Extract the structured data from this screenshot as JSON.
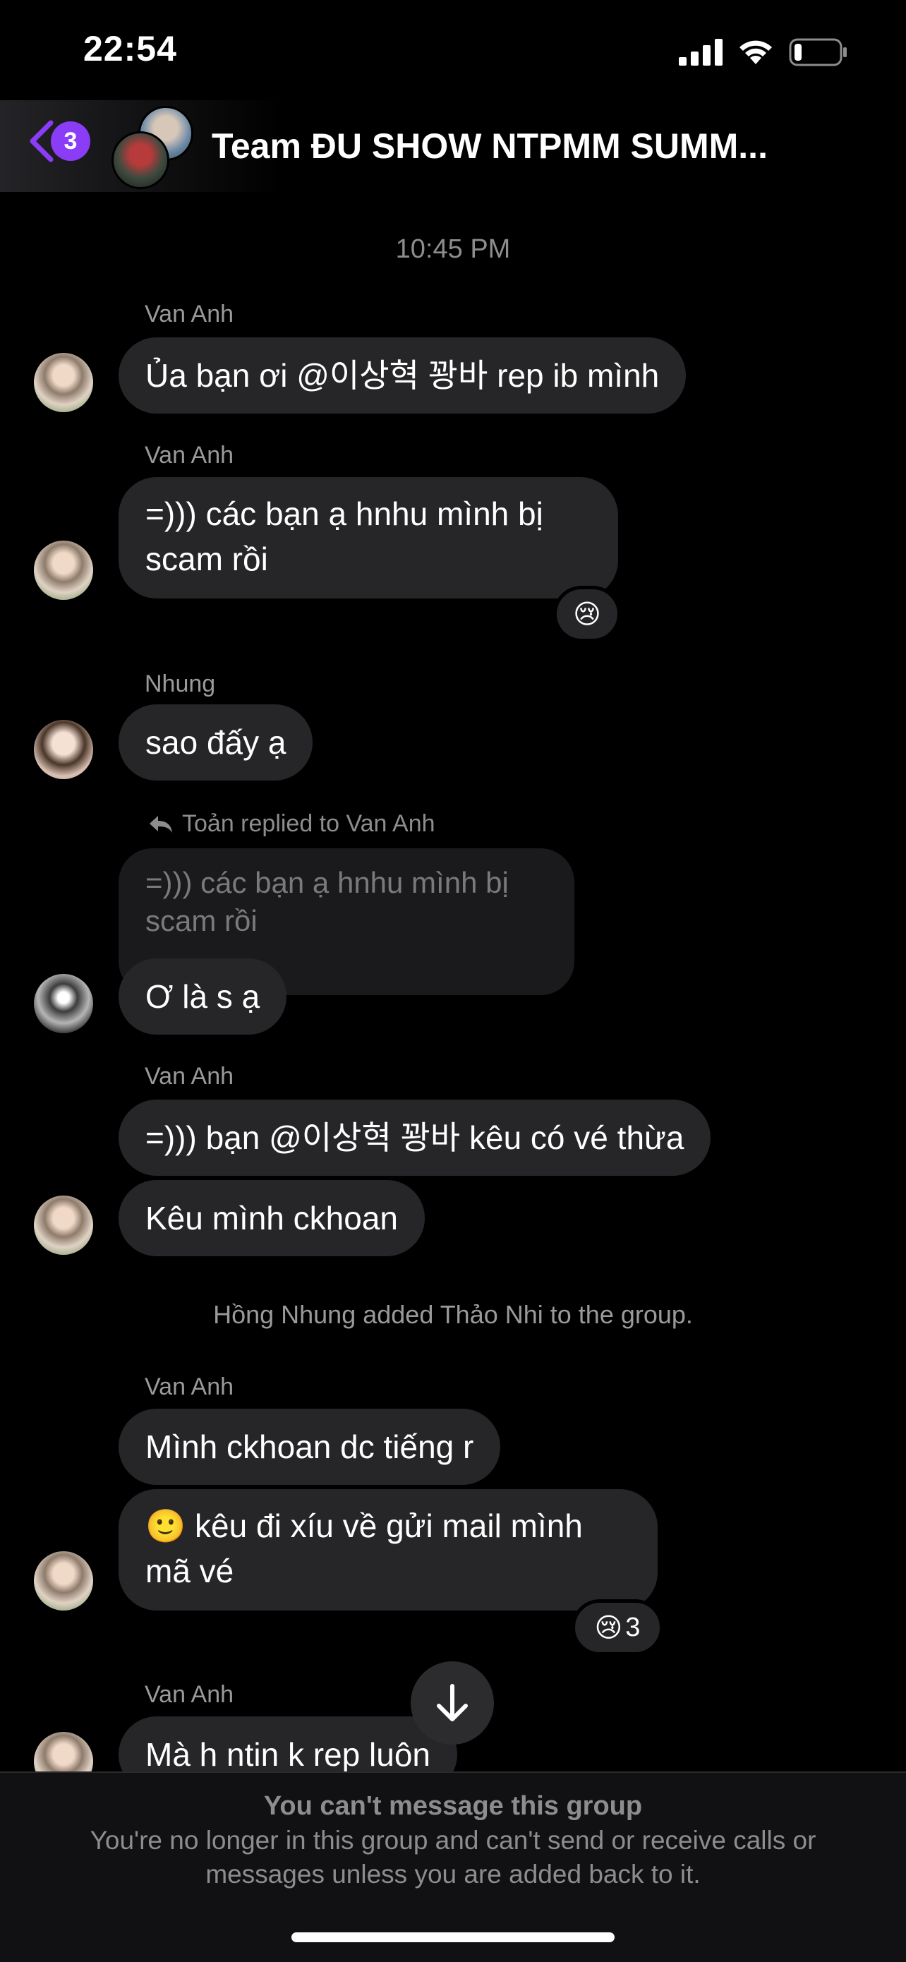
{
  "status_bar": {
    "time": "22:54",
    "icons": [
      "signal-icon",
      "wifi-icon",
      "battery-icon"
    ]
  },
  "header": {
    "back_badge": "3",
    "title": "Team ĐU SHOW NTPMM SUMM..."
  },
  "timestamp": "10:45 PM",
  "messages": [
    {
      "sender": "Van Anh",
      "text": "Ủa bạn ơi @이상혁 꽝바 rep ib mình"
    },
    {
      "sender": "Van Anh",
      "text_line1": "=))) các bạn ạ hnhu mình bị",
      "text_line2": "scam rồi",
      "reaction": "😢"
    },
    {
      "sender": "Nhung",
      "text": "sao đấy ạ"
    },
    {
      "reply_label": "Toản replied to Van Anh",
      "quoted_line1": "=))) các bạn ạ hnhu mình bị",
      "quoted_line2": "scam rồi",
      "text": "Ơ là s ạ"
    },
    {
      "sender": "Van Anh",
      "text": "=))) bạn @이상혁 꽝바 kêu có vé thừa"
    },
    {
      "text": "Kêu mình ckhoan"
    },
    {
      "system": "Hồng Nhung added Thảo Nhi to the group."
    },
    {
      "sender": "Van Anh",
      "text": "Mình ckhoan dc tiếng r"
    },
    {
      "text_line1": "🙂 kêu đi xíu về gửi mail mình",
      "text_line2": "mã vé",
      "reaction": "😢",
      "reaction_count": "3"
    },
    {
      "sender": "Van Anh",
      "text": "Mà h ntin k rep luôn"
    }
  ],
  "footer": {
    "title": "You can't message this group",
    "body": "You're no longer in this group and can't send or receive calls or messages unless you are added back to it."
  },
  "colors": {
    "accent": "#8b3cf6",
    "bubble": "#262628",
    "background": "#000000"
  }
}
